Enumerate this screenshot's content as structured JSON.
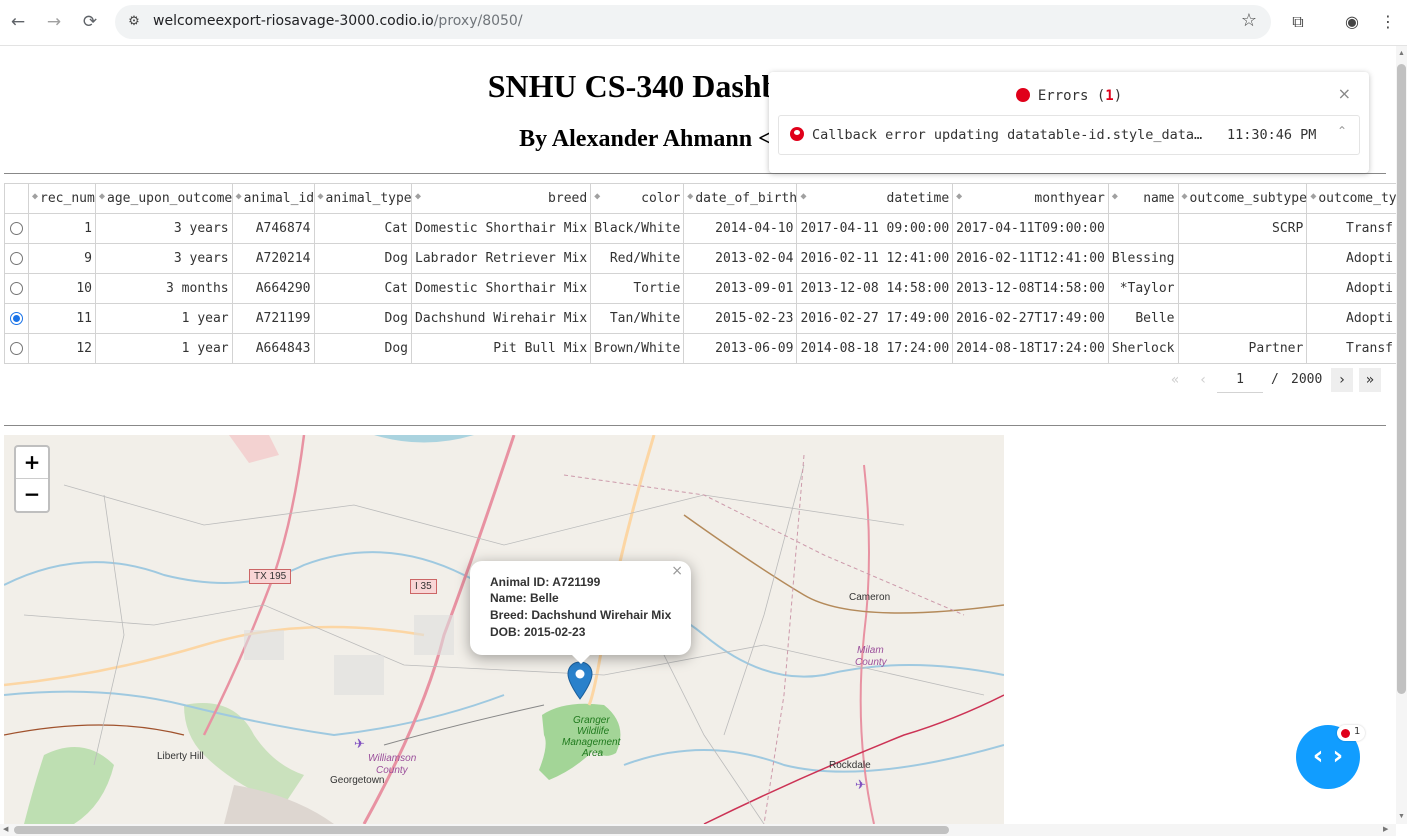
{
  "browser": {
    "back_icon": "arrow-left-icon",
    "forward_icon": "arrow-right-icon",
    "reload_icon": "reload-icon",
    "url_host": "welcomeexport-riosavage-3000.codio.io",
    "url_path": "/proxy/8050/"
  },
  "page": {
    "title": "SNHU CS-340 Dashboard (Mo",
    "subtitle": "By Alexander Ahmann <alexander."
  },
  "table": {
    "columns": [
      "rec_num",
      "age_upon_outcome",
      "animal_id",
      "animal_type",
      "breed",
      "color",
      "date_of_birth",
      "datetime",
      "monthyear",
      "name",
      "outcome_subtype",
      "outcome_ty"
    ],
    "rows": [
      {
        "selected": false,
        "cells": [
          "1",
          "3 years",
          "A746874",
          "Cat",
          "Domestic Shorthair Mix",
          "Black/White",
          "2014-04-10",
          "2017-04-11 09:00:00",
          "2017-04-11T09:00:00",
          "",
          "SCRP",
          "Transf"
        ]
      },
      {
        "selected": false,
        "cells": [
          "9",
          "3 years",
          "A720214",
          "Dog",
          "Labrador Retriever Mix",
          "Red/White",
          "2013-02-04",
          "2016-02-11 12:41:00",
          "2016-02-11T12:41:00",
          "Blessing",
          "",
          "Adopti"
        ]
      },
      {
        "selected": false,
        "cells": [
          "10",
          "3 months",
          "A664290",
          "Cat",
          "Domestic Shorthair Mix",
          "Tortie",
          "2013-09-01",
          "2013-12-08 14:58:00",
          "2013-12-08T14:58:00",
          "*Taylor",
          "",
          "Adopti"
        ]
      },
      {
        "selected": true,
        "cells": [
          "11",
          "1 year",
          "A721199",
          "Dog",
          "Dachshund Wirehair Mix",
          "Tan/White",
          "2015-02-23",
          "2016-02-27 17:49:00",
          "2016-02-27T17:49:00",
          "Belle",
          "",
          "Adopti"
        ]
      },
      {
        "selected": false,
        "cells": [
          "12",
          "1 year",
          "A664843",
          "Dog",
          "Pit Bull Mix",
          "Brown/White",
          "2013-06-09",
          "2014-08-18 17:24:00",
          "2014-08-18T17:24:00",
          "Sherlock",
          "Partner",
          "Transf"
        ]
      }
    ]
  },
  "pager": {
    "current": "1",
    "separator": "/",
    "total": "2000"
  },
  "map": {
    "zoom_in": "+",
    "zoom_out": "−",
    "popup": {
      "line1": "Animal ID: A721199",
      "line2": "Name: Belle",
      "line3": "Breed: Dachshund Wirehair Mix",
      "line4": "DOB: 2015-02-23",
      "close": "×"
    },
    "labels": {
      "tx195": "TX 195",
      "i35": "I 35",
      "cameron": "Cameron",
      "milam1": "Milam",
      "milam2": "County",
      "granger1": "Granger",
      "granger2": "Wildlife",
      "granger3": "Management",
      "granger4": "Area",
      "williamson1": "Williamson",
      "williamson2": "County",
      "liberty_hill": "Liberty Hill",
      "georgetown": "Georgetown",
      "rockdale": "Rockdale"
    }
  },
  "errors": {
    "header_label": "Errors (",
    "count": "1",
    "header_close_paren": ")",
    "close": "×",
    "message": "Callback error updating datatable-id.style_data…",
    "time": "11:30:46 PM",
    "accent": "#e0001a"
  },
  "debug": {
    "badge_count": "1",
    "accent": "#119dff"
  }
}
